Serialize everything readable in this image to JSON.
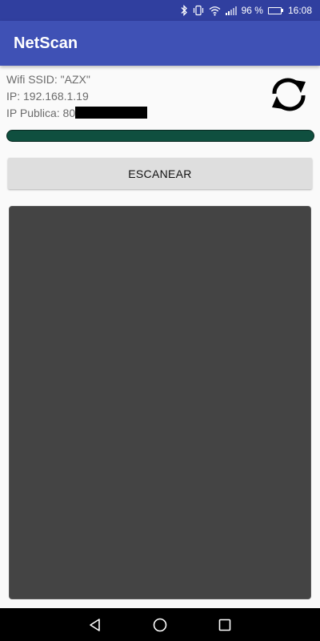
{
  "status_bar": {
    "battery_percent": "96 %",
    "battery_level": 0.96,
    "time": "16:08",
    "icons": [
      "bluetooth-icon",
      "vibrate-icon",
      "wifi-icon",
      "signal-icon",
      "battery-icon"
    ]
  },
  "app_bar": {
    "title": "NetScan",
    "background_color": "#3f51b5"
  },
  "info": {
    "wifi_ssid": "Wifi SSID: \"AZX\"",
    "ip": "IP: 192.168.1.19",
    "public_ip_prefix": "IP Publica: 80"
  },
  "refresh_icon": "refresh-icon",
  "progress": {
    "value": 1.0,
    "color": "#0f4f3f"
  },
  "scan_button": {
    "label": "ESCANEAR"
  },
  "results_panel": {
    "background_color": "#444444"
  },
  "nav_bar": {
    "icons": [
      "back-icon",
      "home-icon",
      "recents-icon"
    ]
  }
}
